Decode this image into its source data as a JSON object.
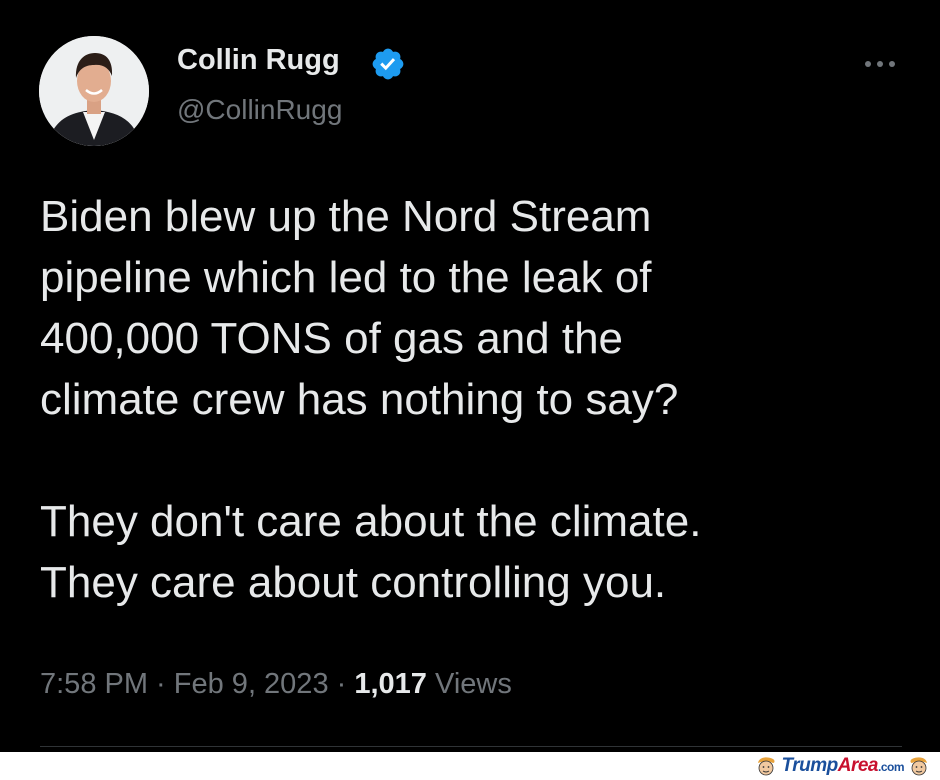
{
  "user": {
    "display_name": "Collin Rugg",
    "handle": "@CollinRugg",
    "verified": true
  },
  "tweet": {
    "text": "Biden blew up the Nord Stream\npipeline which led to the leak of\n400,000 TONS of gas and the\nclimate crew has nothing to say?\n\nThey don't care about the climate.\nThey care about controlling you.",
    "time": "7:58 PM",
    "separator": " · ",
    "date": "Feb 9, 2023",
    "views_count": "1,017",
    "views_label": " Views"
  },
  "watermark": {
    "name_part1": "Trump",
    "name_part2": "Area",
    "domain": ".com"
  },
  "colors": {
    "background": "#000000",
    "text_primary": "#e7e9ea",
    "text_secondary": "#71767b",
    "verified_blue": "#1d9bf0",
    "divider": "#2f3336"
  },
  "icons": {
    "verified": "verified-badge-icon",
    "more": "more-options-icon",
    "watermark_logo": "trump-face-logo"
  }
}
